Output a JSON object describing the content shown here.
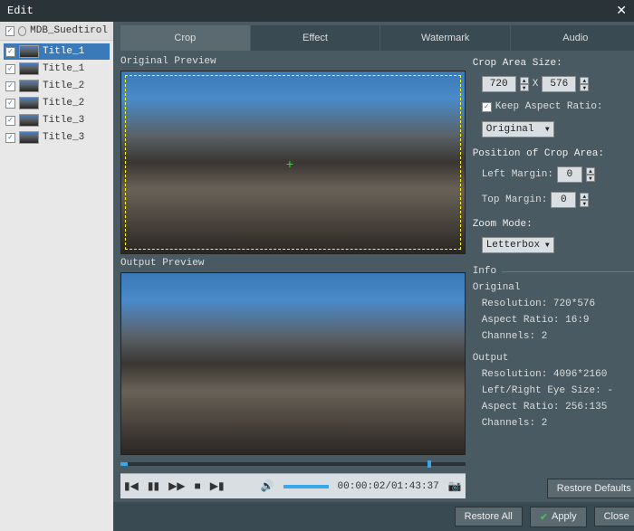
{
  "window": {
    "title": "Edit"
  },
  "sidebar": {
    "project": "MDB_Suedtirol",
    "items": [
      {
        "label": "Title_1",
        "selected": true
      },
      {
        "label": "Title_1",
        "selected": false
      },
      {
        "label": "Title_2",
        "selected": false
      },
      {
        "label": "Title_2",
        "selected": false
      },
      {
        "label": "Title_3",
        "selected": false
      },
      {
        "label": "Title_3",
        "selected": false
      }
    ]
  },
  "tabs": {
    "items": [
      "Crop",
      "Effect",
      "Watermark",
      "Audio"
    ],
    "active": 0
  },
  "preview": {
    "original_label": "Original Preview",
    "output_label": "Output Preview",
    "time": "00:00:02/01:43:37"
  },
  "crop": {
    "size_label": "Crop Area Size:",
    "width": "720",
    "x_label": "X",
    "height": "576",
    "keep_ratio_label": "Keep Aspect Ratio:",
    "ratio_select": "Original",
    "position_label": "Position of Crop Area:",
    "left_margin_label": "Left Margin:",
    "left_margin": "0",
    "top_margin_label": "Top Margin:",
    "top_margin": "0",
    "zoom_label": "Zoom Mode:",
    "zoom_select": "Letterbox"
  },
  "info": {
    "heading": "Info",
    "original_heading": "Original",
    "original_resolution": "Resolution: 720*576",
    "original_ratio": "Aspect Ratio: 16:9",
    "original_channels": "Channels: 2",
    "output_heading": "Output",
    "output_resolution": "Resolution: 4096*2160",
    "output_eye": "Left/Right Eye Size: -",
    "output_ratio": "Aspect Ratio: 256:135",
    "output_channels": "Channels: 2",
    "restore_label": "Restore Defaults"
  },
  "footer": {
    "restore_all": "Restore All",
    "apply": "Apply",
    "close": "Close"
  }
}
